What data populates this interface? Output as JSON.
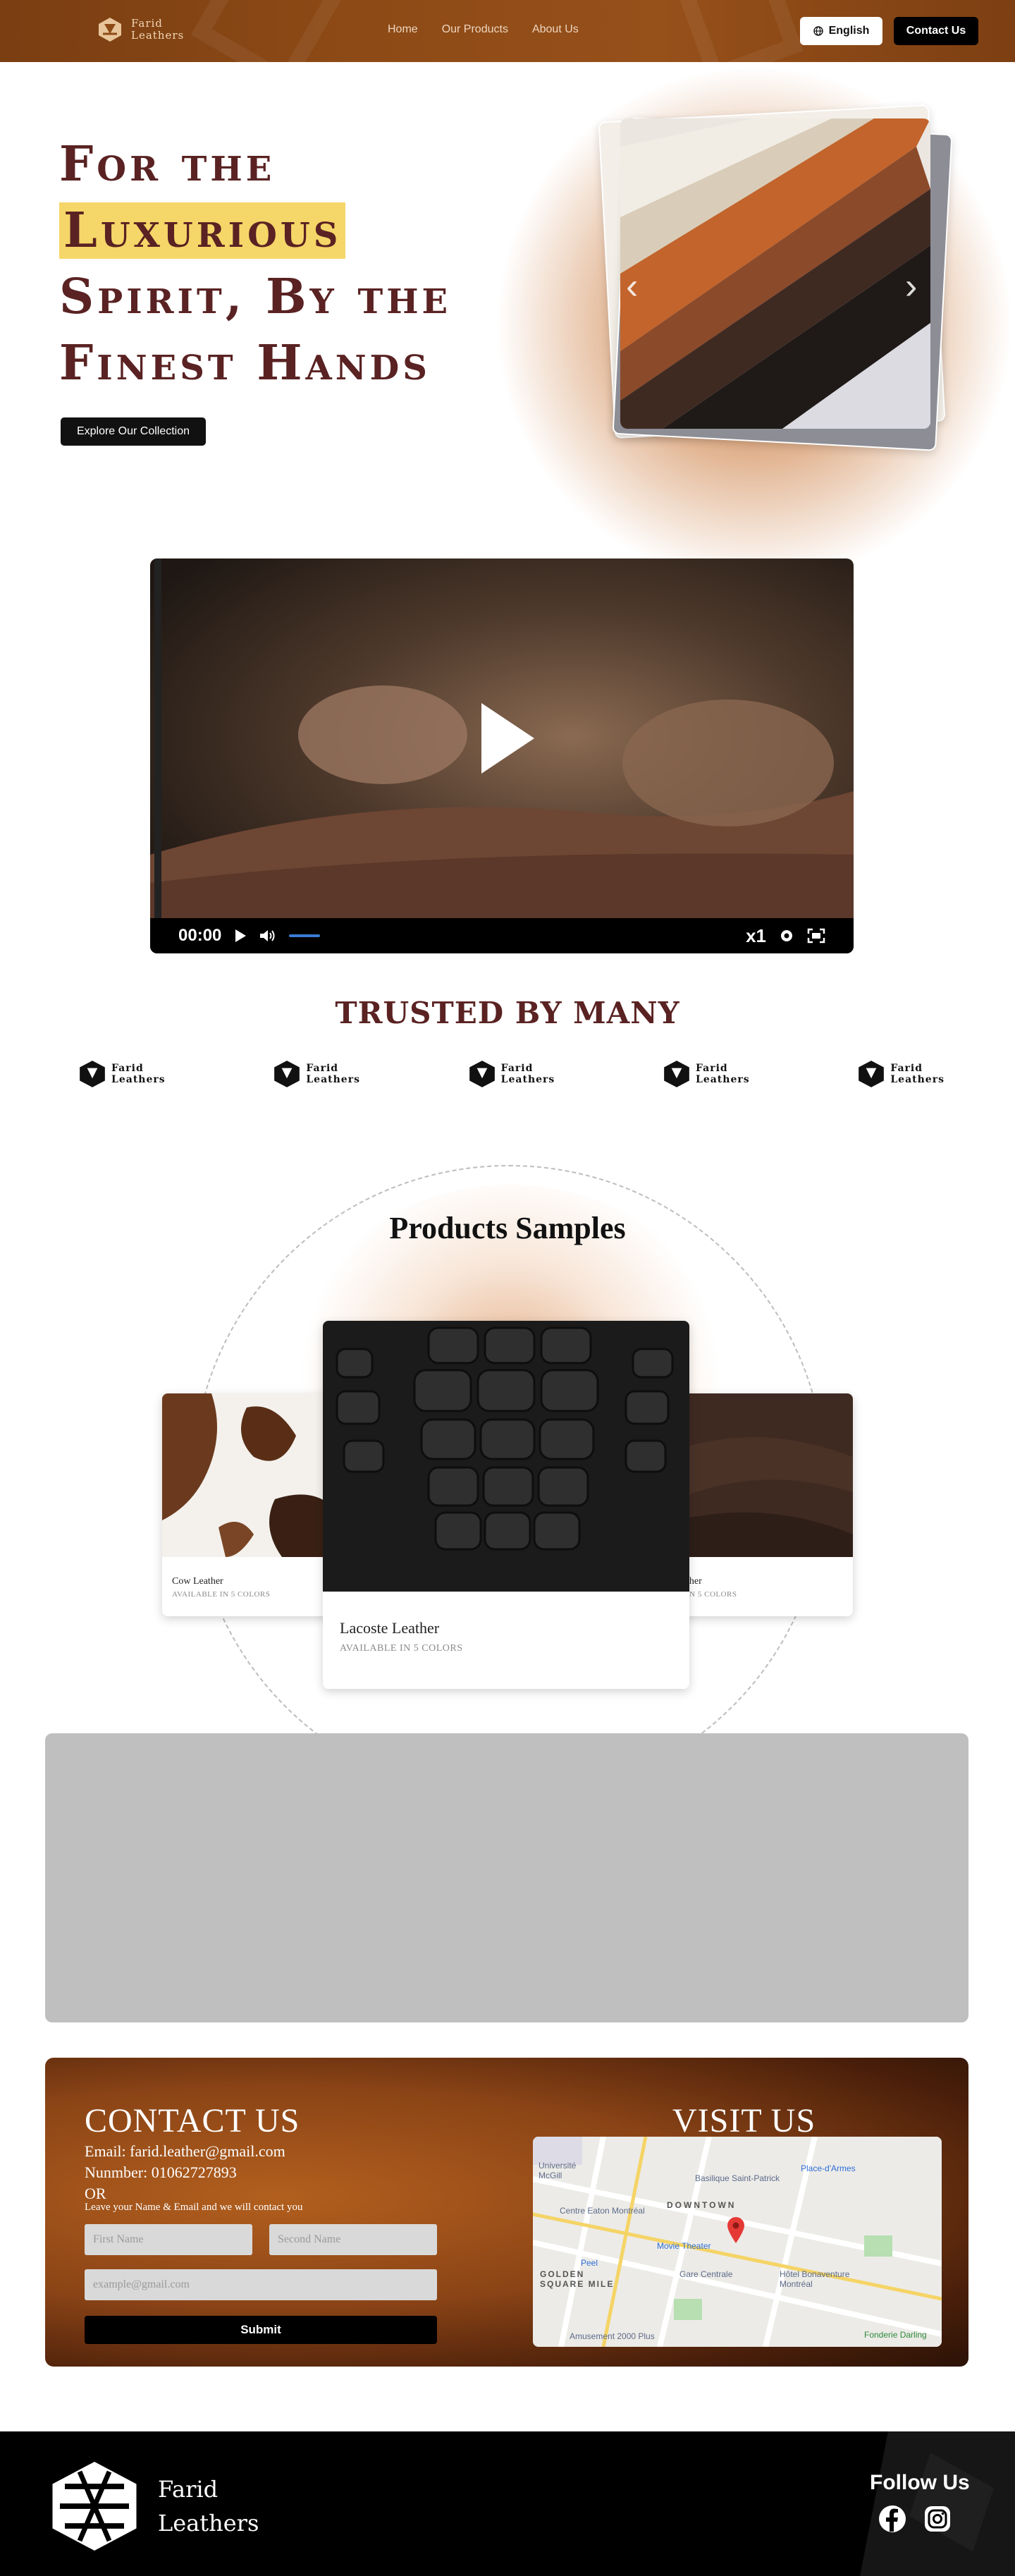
{
  "nav": {
    "brand_line1": "Farid",
    "brand_line2": "Leathers",
    "links": [
      {
        "label": "Home"
      },
      {
        "label": "Our Products"
      },
      {
        "label": "About Us"
      }
    ],
    "language": "English",
    "contact_button": "Contact Us"
  },
  "hero": {
    "line1": "For the",
    "line2": "Luxurious",
    "line3": "Spirit, By the",
    "line4": "Finest Hands",
    "cta": "Explore Our Collection"
  },
  "video": {
    "time": "00:00",
    "speed": "x1"
  },
  "trusted": {
    "title": "TRUSTED BY MANY",
    "logos": [
      {
        "line1": "Farid",
        "line2": "Leathers"
      },
      {
        "line1": "Farid",
        "line2": "Leathers"
      },
      {
        "line1": "Farid",
        "line2": "Leathers"
      },
      {
        "line1": "Farid",
        "line2": "Leathers"
      },
      {
        "line1": "Farid",
        "line2": "Leathers"
      }
    ]
  },
  "products": {
    "title": "Products Samples",
    "items": [
      {
        "name": "Cow Leather",
        "sub": "AVAILABLE IN 5 COLORS"
      },
      {
        "name": "Lacoste Leather",
        "sub": "AVAILABLE IN 5 COLORS"
      },
      {
        "name": "ther",
        "sub": "IN 5 COLORS"
      }
    ]
  },
  "contact": {
    "title": "CONTACT US",
    "email": "Email: farid.leather@gmail.com",
    "number": "Nunmber: 01062727893",
    "or": "OR",
    "note": "Leave your Name & Email and we will contact you",
    "first_name_placeholder": "First Name",
    "second_name_placeholder": "Second Name",
    "email_placeholder": "example@gmail.com",
    "submit": "Submit",
    "visit_title": "VISIT US",
    "map_labels": {
      "mcgill": "Université McGill",
      "basilique": "Basilique Saint-Patrick",
      "place_armes": "Place-d'Armes",
      "downtown": "DOWNTOWN",
      "eaton": "Centre Eaton Montréal",
      "movie": "Movie Theater",
      "golden": "GOLDEN SQUARE MILE",
      "peel": "Peel",
      "gare": "Gare Centrale",
      "bonaventure": "Hôtel Bonaventure Montréal",
      "amusement": "Amusement 2000 Plus",
      "fonderie": "Fonderie Darling"
    }
  },
  "footer": {
    "brand_line1": "Farid",
    "brand_line2": "Leathers",
    "follow": "Follow Us"
  }
}
